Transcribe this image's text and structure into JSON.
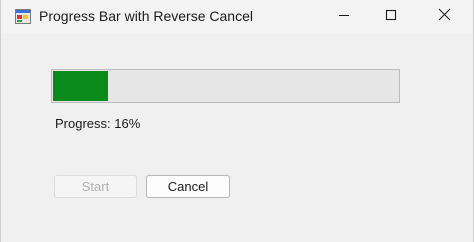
{
  "window": {
    "title": "Progress Bar with Reverse Cancel",
    "icons": {
      "app": "app-window-icon",
      "minimize": "minimize-icon",
      "maximize": "maximize-icon",
      "close": "close-icon"
    }
  },
  "progress": {
    "value_percent": 16,
    "fill_color": "#0a8a1a",
    "track_color": "#e6e6e6",
    "label": "Progress: 16%"
  },
  "buttons": {
    "start_label": "Start",
    "start_enabled": false,
    "cancel_label": "Cancel",
    "cancel_enabled": true
  }
}
